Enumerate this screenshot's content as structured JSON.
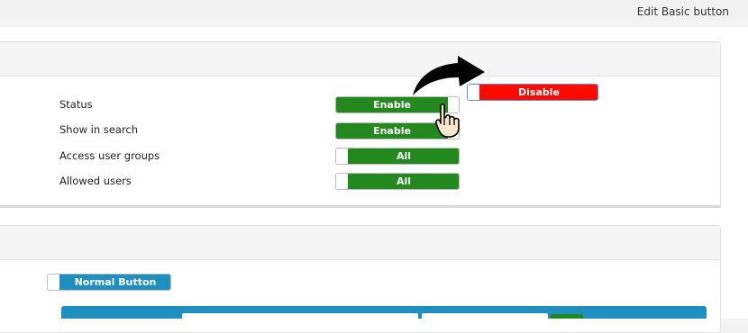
{
  "header": {
    "title": "Edit Basic button"
  },
  "settings": {
    "rows": [
      {
        "label": "Status",
        "toggle_label": "Enable"
      },
      {
        "label": "Show in search",
        "toggle_label": "Enable"
      },
      {
        "label": "Access user groups",
        "toggle_label": "All"
      },
      {
        "label": "Allowed users",
        "toggle_label": "All"
      }
    ],
    "disabled_preview_label": "Disable"
  },
  "section2": {
    "button_label": "Normal Button"
  },
  "colors": {
    "enabled": "#23891f",
    "disabled": "#ff0a00",
    "accent": "#1f8fc0"
  },
  "icons": {
    "arrow": "curved-arrow-icon",
    "cursor": "hand-pointer-icon"
  }
}
